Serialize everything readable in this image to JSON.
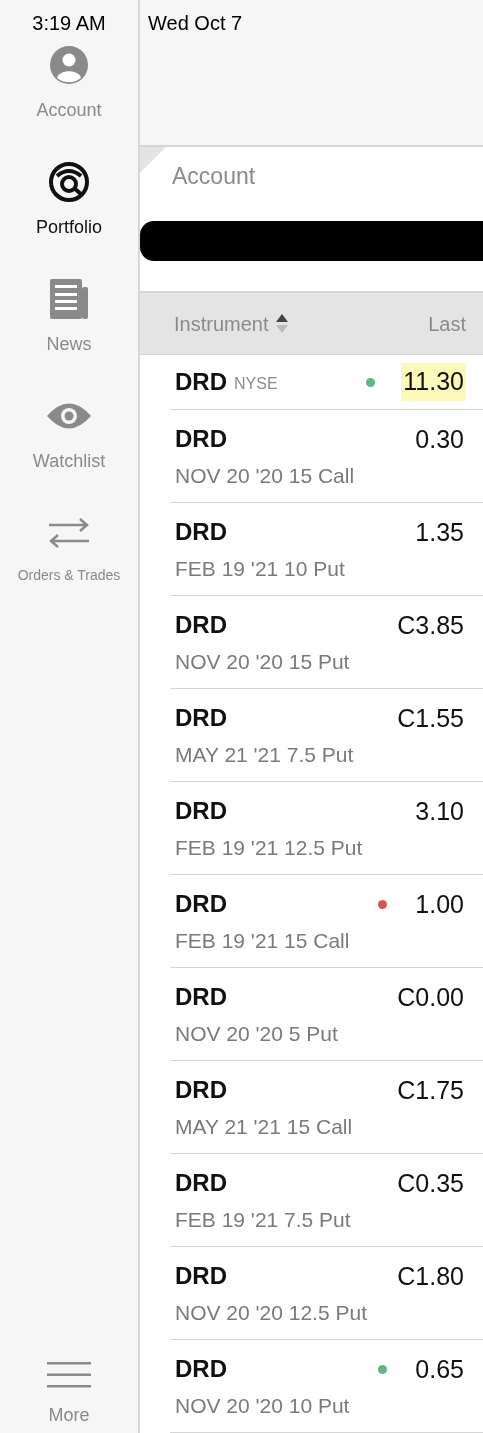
{
  "status_bar": {
    "time": "3:19 AM",
    "date": "Wed Oct 7"
  },
  "sidebar": {
    "items": [
      {
        "kind": "account",
        "label": "Account",
        "selected": false
      },
      {
        "kind": "portfolio",
        "label": "Portfolio",
        "selected": true
      },
      {
        "kind": "news",
        "label": "News",
        "selected": false
      },
      {
        "kind": "watchlist",
        "label": "Watchlist",
        "selected": false
      },
      {
        "kind": "orders",
        "label": "Orders & Trades",
        "selected": false
      }
    ],
    "more": {
      "label": "More"
    }
  },
  "account": {
    "title": "Account"
  },
  "table": {
    "columns": [
      {
        "label": "Instrument",
        "sorted": true
      },
      {
        "label": "Last"
      }
    ],
    "rows": [
      {
        "symbol": "DRD",
        "exchange": "NYSE",
        "last": "11.30",
        "highlighted": true,
        "color": "#5cb87f"
      },
      {
        "symbol": "DRD",
        "description": "NOV 20 '20 15 Call",
        "last": "0.30",
        "highlighted": false
      },
      {
        "symbol": "DRD",
        "description": "FEB 19 '21 10 Put",
        "last": "1.35",
        "highlighted": false
      },
      {
        "symbol": "DRD",
        "description": "NOV 20 '20 15 Put",
        "last": "C3.85",
        "highlighted": false
      },
      {
        "symbol": "DRD",
        "description": "MAY 21 '21 7.5 Put",
        "last": "C1.55",
        "highlighted": false
      },
      {
        "symbol": "DRD",
        "description": "FEB 19 '21 12.5 Put",
        "last": "3.10",
        "highlighted": false
      },
      {
        "symbol": "DRD",
        "description": "FEB 19 '21 15 Call",
        "last": "1.00",
        "highlighted": false,
        "color": "#d9534a"
      },
      {
        "symbol": "DRD",
        "description": "NOV 20 '20 5 Put",
        "last": "C0.00",
        "highlighted": false
      },
      {
        "symbol": "DRD",
        "description": "MAY 21 '21 15 Call",
        "last": "C1.75",
        "highlighted": false
      },
      {
        "symbol": "DRD",
        "description": "FEB 19 '21 7.5 Put",
        "last": "C0.35",
        "highlighted": false
      },
      {
        "symbol": "DRD",
        "description": "NOV 20 '20 12.5 Put",
        "last": "C1.80",
        "highlighted": false
      },
      {
        "symbol": "DRD",
        "description": "NOV 20 '20 10 Put",
        "last": "0.65",
        "highlighted": false,
        "color": "#5cb87f"
      }
    ]
  }
}
